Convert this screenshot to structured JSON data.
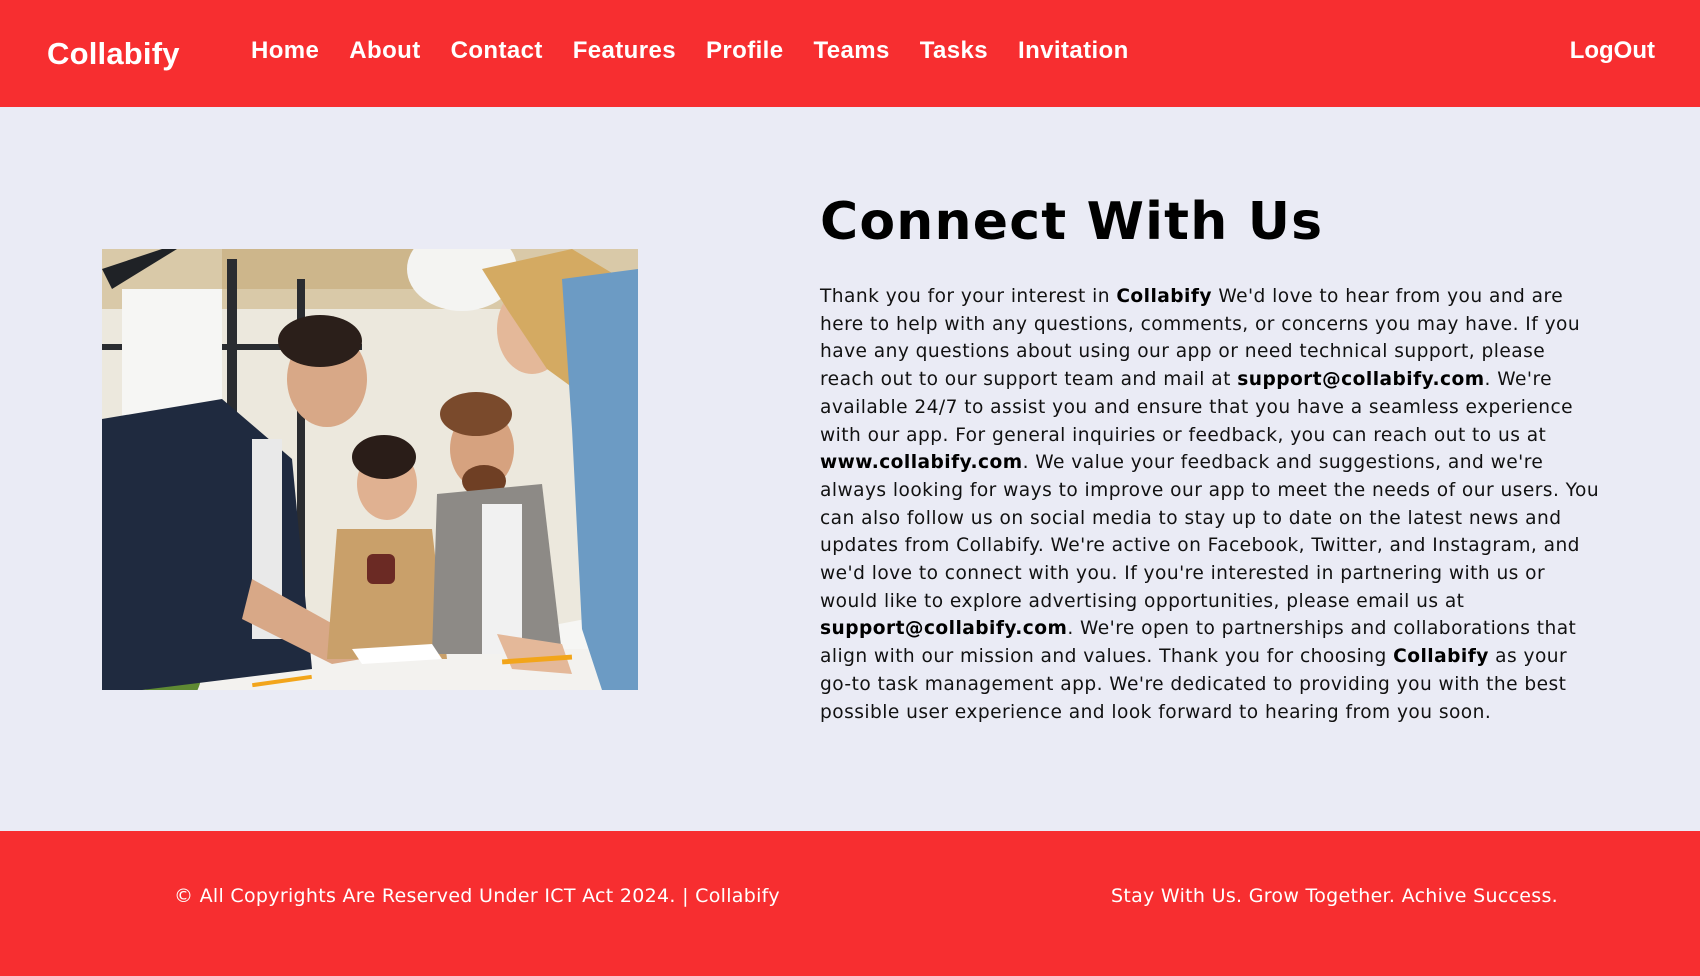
{
  "navbar": {
    "brand": "Collabify",
    "links": [
      "Home",
      "About",
      "Contact",
      "Features",
      "Profile",
      "Teams",
      "Tasks",
      "Invitation"
    ],
    "logout": "LogOut"
  },
  "colors": {
    "brand_red": "#f72e30",
    "page_background": "#eaebf5",
    "nav_text": "#ffffff"
  },
  "image": {
    "icon": "team-meeting-photo"
  },
  "contact": {
    "heading": "Connect With Us",
    "p1": "Thank you for your interest in ",
    "b1": "Collabify",
    "p2": " We'd love to hear from you and are here to help with any questions, comments, or concerns you may have. If you have any questions about using our app or need technical support, please reach out to our support team and mail at ",
    "b2": "support@collabify.com",
    "p3": ". We're available 24/7 to assist you and ensure that you have a seamless experience with our app. For general inquiries or feedback, you can reach out to us at ",
    "b3": "www.collabify.com",
    "p4": ". We value your feedback and suggestions, and we're always looking for ways to improve our app to meet the needs of our users. You can also follow us on social media to stay up to date on the latest news and updates from Collabify. We're active on Facebook, Twitter, and Instagram, and we'd love to connect with you. If you're interested in partnering with us or would like to explore advertising opportunities, please email us at ",
    "b4": "support@collabify.com",
    "p5": ". We're open to partnerships and collaborations that align with our mission and values. Thank you for choosing ",
    "b5": "Collabify",
    "p6": " as your go-to task management app. We're dedicated to providing you with the best possible user experience and look forward to hearing from you soon."
  },
  "footer": {
    "copyright": "© All Copyrights Are Reserved Under ICT Act 2024. | Collabify",
    "tagline": "Stay With Us. Grow Together. Achive Success."
  }
}
